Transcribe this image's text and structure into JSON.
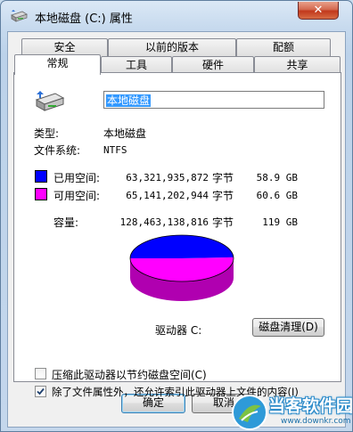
{
  "window": {
    "title": "本地磁盘 (C:) 属性",
    "close_glyph": "✕"
  },
  "tabs": {
    "row1": [
      "安全",
      "以前的版本",
      "配额"
    ],
    "row2": [
      "常规",
      "工具",
      "硬件",
      "共享"
    ],
    "active": "常规"
  },
  "general": {
    "drive_name": "本地磁盘",
    "type_label": "类型:",
    "type_value": "本地磁盘",
    "fs_label": "文件系统:",
    "fs_value": "NTFS",
    "used": {
      "label": "已用空间:",
      "bytes": "63,321,935,872",
      "unit": "字节",
      "size": "58.9 GB",
      "color": "#0000ff"
    },
    "free": {
      "label": "可用空间:",
      "bytes": "65,141,202,944",
      "unit": "字节",
      "size": "60.6 GB",
      "color": "#ff00ff"
    },
    "capacity": {
      "label": "容量:",
      "bytes": "128,463,138,816",
      "unit": "字节",
      "size": "119 GB"
    },
    "used_fraction": 0.493,
    "drive_label": "驱动器 C:",
    "cleanup_button": "磁盘清理(D)",
    "compress_checkbox": {
      "label": "压缩此驱动器以节约磁盘空间(C)",
      "checked": false
    },
    "index_checkbox": {
      "label": "除了文件属性外，还允许索引此驱动器上文件的内容(I)",
      "checked": true
    }
  },
  "buttons": {
    "ok": "确定",
    "cancel": "取消"
  },
  "icons": {
    "title": "drive-icon",
    "drive": "hard-drive-icon"
  },
  "watermark": {
    "text": "当客软件园",
    "url": "www.downkr.com"
  }
}
